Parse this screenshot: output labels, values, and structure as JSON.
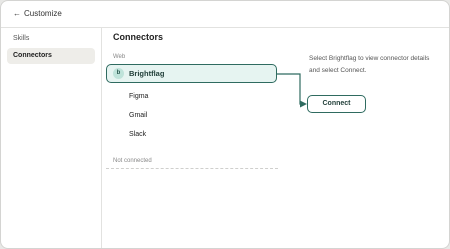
{
  "topbar": {
    "back_label": "Customize"
  },
  "sidebar": {
    "items": [
      {
        "label": "Skills",
        "active": false
      },
      {
        "label": "Connectors",
        "active": true
      }
    ]
  },
  "main": {
    "title": "Connectors",
    "web_section_label": "Web",
    "selected_connector": {
      "badge": "b",
      "name": "Brightflag"
    },
    "connectors": [
      {
        "name": "Figma"
      },
      {
        "name": "Gmail"
      },
      {
        "name": "Slack"
      }
    ],
    "not_connected_label": "Not connected"
  },
  "detail": {
    "hint": "Select Brightflag to view connector details and select Connect.",
    "connect_label": "Connect"
  },
  "colors": {
    "accent": "#2f6b60",
    "selected_bg": "#e6f4f1",
    "active_nav_bg": "#eeede9"
  }
}
